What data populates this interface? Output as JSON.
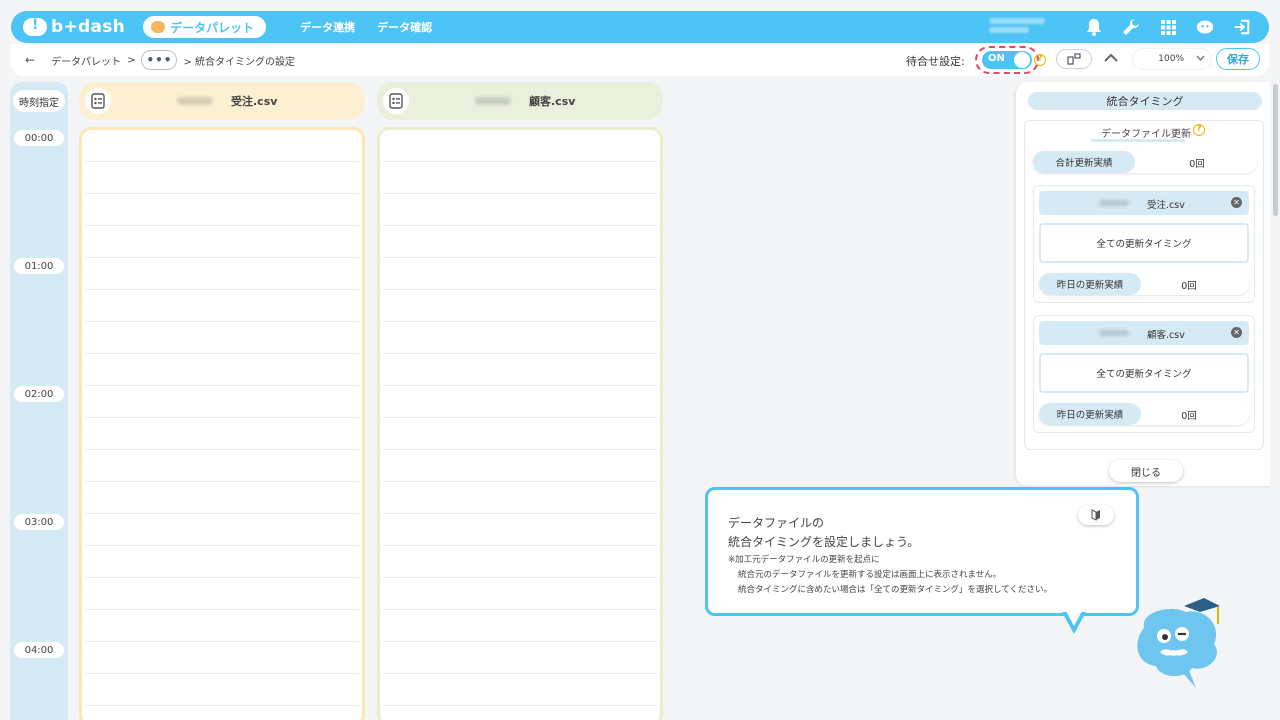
{
  "header": {
    "logo": "b+dash",
    "active_nav": "データパレット",
    "nav_links": [
      "データ連携",
      "データ確認"
    ]
  },
  "toolbar": {
    "crumb_root": "データパレット",
    "crumb_sep": ">",
    "crumb_more": "•••",
    "crumb_current": "> 統合タイミングの設定",
    "wait_label": "待合せ設定:",
    "toggle_on": "ON",
    "zoom": "100%",
    "save": "保存"
  },
  "timeline": {
    "head": "時刻指定",
    "ticks": [
      "00:00",
      "01:00",
      "02:00",
      "03:00",
      "04:00"
    ]
  },
  "files": [
    {
      "name": "受注.csv",
      "color": "#fdf0d2",
      "border": "#fbe7b3"
    },
    {
      "name": "顧客.csv",
      "color": "#ebf0dc",
      "border": "#ecedd0"
    }
  ],
  "panel": {
    "title": "統合タイミング",
    "section": "データファイル更新",
    "total_label": "合計更新実績",
    "total_value": "0回",
    "cards": [
      {
        "name": "受注.csv",
        "select": "全ての更新タイミング",
        "stat_label": "昨日の更新実績",
        "stat_value": "0回"
      },
      {
        "name": "顧客.csv",
        "select": "全ての更新タイミング",
        "stat_label": "昨日の更新実績",
        "stat_value": "0回"
      }
    ],
    "close": "閉じる"
  },
  "tooltip": {
    "line1": "データファイルの",
    "line2": "統合タイミングを設定しましょう。",
    "note1": "※加工元データファイルの更新を起点に",
    "note2": "統合元のデータファイルを更新する設定は画面上に表示されません。",
    "note3": "統合タイミングに含めたい場合は「全ての更新タイミング」を選択してください。"
  }
}
